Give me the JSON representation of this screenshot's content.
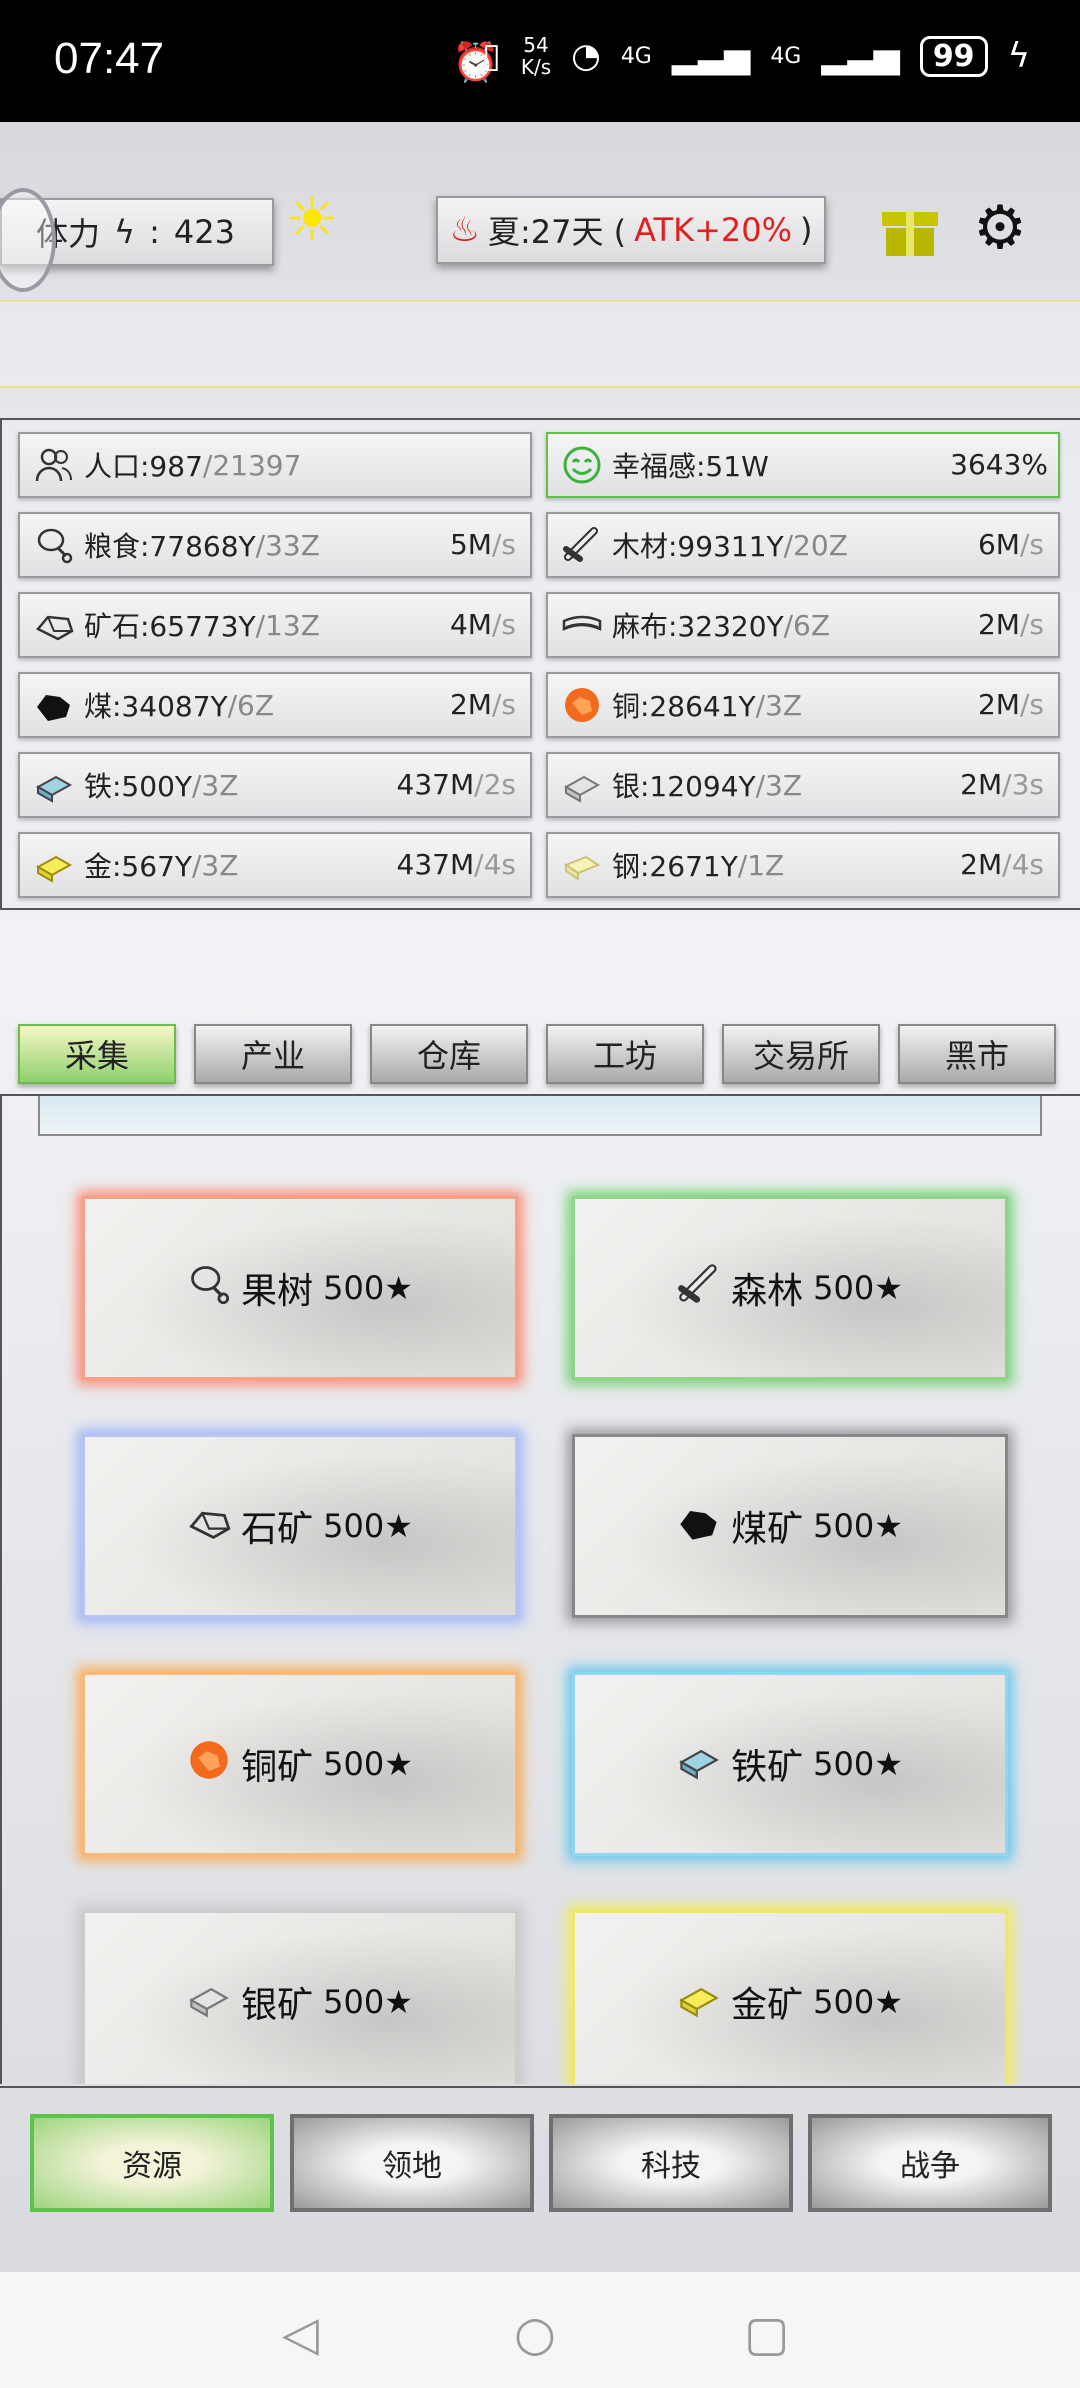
{
  "status_bar": {
    "time": "07:47",
    "net_speed_top": "54",
    "net_speed_bottom": "K/s",
    "signal1": "4G",
    "signal2": "4G",
    "battery": "99"
  },
  "top_bar": {
    "stamina_label": "体力",
    "stamina_sep": ":",
    "stamina_value": "423",
    "season_text": "夏:27天 (",
    "season_bonus": "ATK+20%",
    "season_close": ")",
    "icons": [
      "sun-icon",
      "fire-icon",
      "gift-icon",
      "gear-icon"
    ]
  },
  "resources": [
    {
      "icon": "people-icon",
      "name": "人口:987",
      "cap": "/21397",
      "rate": "",
      "unit": ""
    },
    {
      "icon": "smile-icon",
      "name": "幸福感:51W",
      "cap": "",
      "rate": "3643%",
      "unit": ""
    },
    {
      "icon": "meat-icon",
      "name": "粮食:77868Y",
      "cap": "/33Z",
      "rate": "5M",
      "unit": "/s"
    },
    {
      "icon": "wood-icon",
      "name": "木材:99311Y",
      "cap": "/20Z",
      "rate": "6M",
      "unit": "/s"
    },
    {
      "icon": "stone-icon",
      "name": "矿石:65773Y",
      "cap": "/13Z",
      "rate": "4M",
      "unit": "/s"
    },
    {
      "icon": "cloth-icon",
      "name": "麻布:32320Y",
      "cap": "/6Z",
      "rate": "2M",
      "unit": "/s"
    },
    {
      "icon": "coal-icon",
      "name": "煤:34087Y",
      "cap": "/6Z",
      "rate": "2M",
      "unit": "/s"
    },
    {
      "icon": "copper-icon",
      "name": "铜:28641Y",
      "cap": "/3Z",
      "rate": "2M",
      "unit": "/s"
    },
    {
      "icon": "iron-icon",
      "name": "铁:500Y",
      "cap": "/3Z",
      "rate": "437M",
      "unit": "/2s"
    },
    {
      "icon": "silver-icon",
      "name": "银:12094Y",
      "cap": "/3Z",
      "rate": "2M",
      "unit": "/3s"
    },
    {
      "icon": "gold-icon",
      "name": "金:567Y",
      "cap": "/3Z",
      "rate": "437M",
      "unit": "/4s"
    },
    {
      "icon": "steel-icon",
      "name": "钢:2671Y",
      "cap": "/1Z",
      "rate": "2M",
      "unit": "/4s"
    }
  ],
  "sub_tabs": [
    "采集",
    "产业",
    "仓库",
    "工坊",
    "交易所",
    "黑市"
  ],
  "tiles": [
    {
      "icon": "meat-icon",
      "label": "果树",
      "stars": "500★"
    },
    {
      "icon": "wood-icon",
      "label": "森林",
      "stars": "500★"
    },
    {
      "icon": "stone-icon",
      "label": "石矿",
      "stars": "500★"
    },
    {
      "icon": "coal-icon",
      "label": "煤矿",
      "stars": "500★"
    },
    {
      "icon": "copper-icon",
      "label": "铜矿",
      "stars": "500★"
    },
    {
      "icon": "iron-icon",
      "label": "铁矿",
      "stars": "500★"
    },
    {
      "icon": "silver-icon",
      "label": "银矿",
      "stars": "500★"
    },
    {
      "icon": "gold-icon",
      "label": "金矿",
      "stars": "500★"
    }
  ],
  "bottom_nav": [
    "资源",
    "领地",
    "科技",
    "战争"
  ],
  "colors": {
    "active_green": "#6bbd49",
    "bonus_red": "#e0201e",
    "gift_yellow": "#c7c400"
  }
}
